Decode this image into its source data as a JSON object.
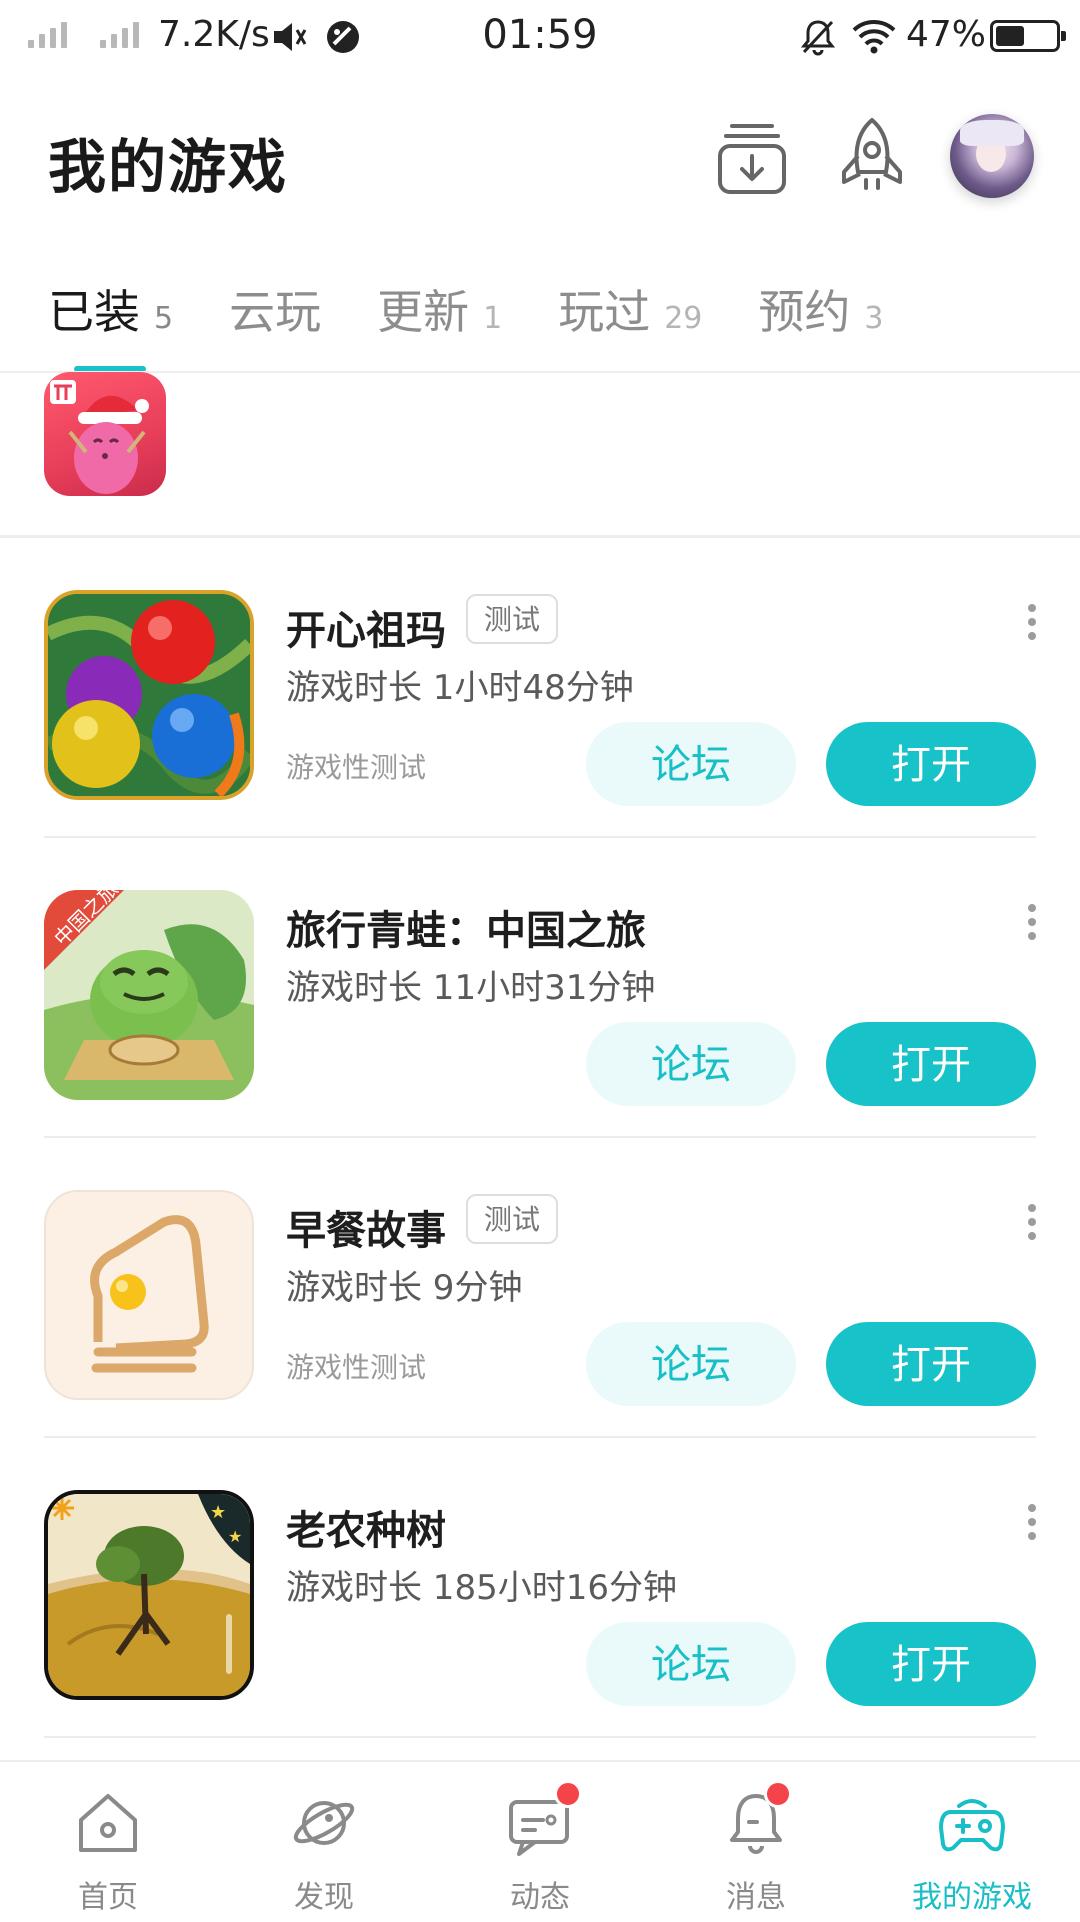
{
  "status_bar": {
    "speed": "7.2K/s",
    "time": "01:59",
    "battery": "47%"
  },
  "header": {
    "title": "我的游戏"
  },
  "tabs": [
    {
      "label": "已装",
      "count": "5",
      "active": true
    },
    {
      "label": "云玩",
      "count": ""
    },
    {
      "label": "更新",
      "count": "1"
    },
    {
      "label": "玩过",
      "count": "29"
    },
    {
      "label": "预约",
      "count": "3"
    }
  ],
  "games": [
    {
      "name": "开心祖玛",
      "tag": "测试",
      "playtime": "游戏时长 1小时48分钟",
      "note": "游戏性测试",
      "forum": "论坛",
      "open": "打开"
    },
    {
      "name": "旅行青蛙：中国之旅",
      "tag": "",
      "playtime": "游戏时长 11小时31分钟",
      "note": "",
      "forum": "论坛",
      "open": "打开"
    },
    {
      "name": "早餐故事",
      "tag": "测试",
      "playtime": "游戏时长 9分钟",
      "note": "游戏性测试",
      "forum": "论坛",
      "open": "打开"
    },
    {
      "name": "老农种树",
      "tag": "",
      "playtime": "游戏时长 185小时16分钟",
      "note": "",
      "forum": "论坛",
      "open": "打开"
    }
  ],
  "bottom_nav": [
    {
      "label": "首页",
      "icon": "home-icon"
    },
    {
      "label": "发现",
      "icon": "planet-icon"
    },
    {
      "label": "动态",
      "icon": "chat-icon",
      "badge": true
    },
    {
      "label": "消息",
      "icon": "bell-icon",
      "badge": true
    },
    {
      "label": "我的游戏",
      "icon": "gamepad-icon",
      "active": true
    }
  ],
  "colors": {
    "accent": "#17c2c8",
    "forum_bg": "#eaf9fa",
    "badge": "#f5434a"
  }
}
